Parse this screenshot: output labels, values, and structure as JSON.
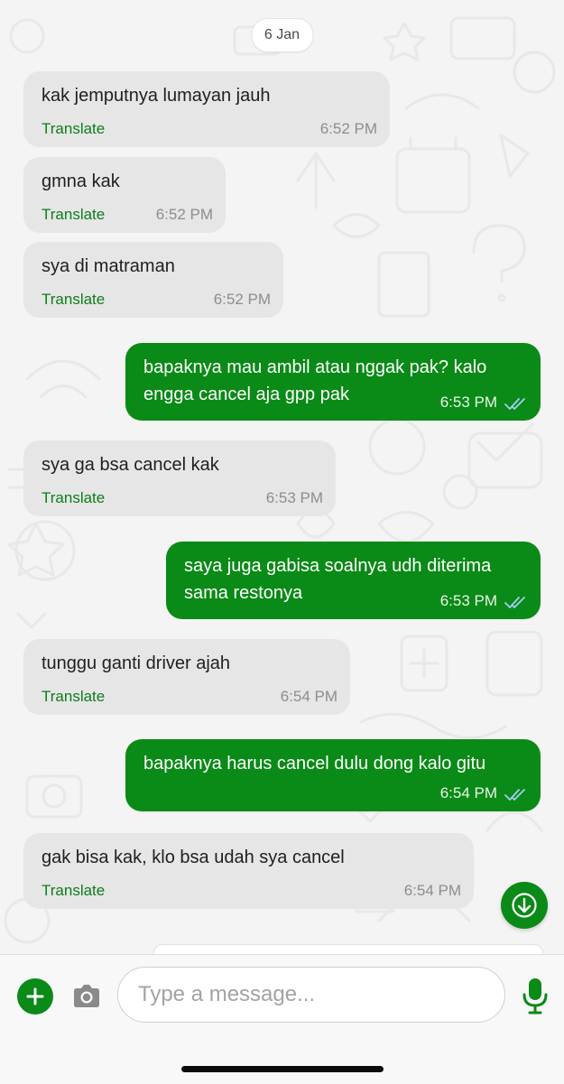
{
  "date_chip": "6 Jan",
  "messages": [
    {
      "direction": "in",
      "text": "kak jemputnya lumayan jauh",
      "translate": "Translate",
      "time": "6:52 PM"
    },
    {
      "direction": "in",
      "text": "gmna kak",
      "translate": "Translate",
      "time": "6:52 PM"
    },
    {
      "direction": "in",
      "text": "sya di matraman",
      "translate": "Translate",
      "time": "6:52 PM"
    },
    {
      "direction": "out",
      "text": "bapaknya mau ambil atau nggak pak? kalo engga cancel aja gpp pak",
      "time": "6:53 PM",
      "status": "read-ticks-icon"
    },
    {
      "direction": "in",
      "text": "sya ga bsa cancel kak",
      "translate": "Translate",
      "time": "6:53 PM"
    },
    {
      "direction": "out",
      "text": "saya juga gabisa soalnya udh diterima sama restonya",
      "time": "6:53 PM",
      "status": "read-ticks-icon"
    },
    {
      "direction": "in",
      "text": "tunggu ganti driver ajah",
      "translate": "Translate",
      "time": "6:54 PM"
    },
    {
      "direction": "out",
      "text": "bapaknya harus cancel dulu dong kalo gitu",
      "time": "6:54 PM",
      "status": "read-ticks-icon"
    },
    {
      "direction": "in",
      "text": "gak bisa kak, klo bsa udah sya cancel",
      "translate": "Translate",
      "time": "6:54 PM"
    }
  ],
  "input": {
    "placeholder": "Type a message..."
  },
  "icons": {
    "add": "plus-icon",
    "camera": "camera-icon",
    "mic": "microphone-icon",
    "scroll": "arrow-down-icon"
  },
  "colors": {
    "accent": "#0a8a16",
    "incoming_bubble": "#e6e6e6",
    "outgoing_bubble": "#0a8a16",
    "translate_link": "#0e7d1a",
    "read_ticks": "#9fd0f5"
  }
}
